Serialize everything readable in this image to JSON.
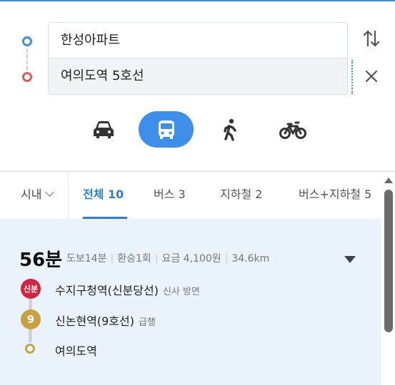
{
  "route": {
    "origin": "한성아파트",
    "destination": "여의도역 5호선"
  },
  "modes": [
    {
      "name": "car",
      "icon": "car-icon"
    },
    {
      "name": "transit",
      "icon": "bus-icon",
      "active": true
    },
    {
      "name": "walk",
      "icon": "walk-icon"
    },
    {
      "name": "bike",
      "icon": "bicycle-icon"
    }
  ],
  "tabs": {
    "region": "시내",
    "all": "전체 10",
    "bus": "버스 3",
    "subway": "지하철 2",
    "bus_subway": "버스+지하철 5"
  },
  "result": {
    "duration": "56분",
    "walk": "도보14분",
    "transfer": "환승1회",
    "fare": "요금 4,100원",
    "distance": "34.6km",
    "steps": [
      {
        "badge": "신분",
        "name": "수지구청역(신분당선)",
        "note": "신사 방면",
        "color": "#d4233c"
      },
      {
        "badge": "9",
        "name": "신논현역(9호선)",
        "note": "급행",
        "color": "#c9a13f"
      },
      {
        "name": "여의도역"
      }
    ]
  },
  "colors": {
    "accent": "#3d8fe9",
    "origin": "#3b8fe6",
    "destination": "#ea5555",
    "result_bg": "#eaf2fb"
  }
}
